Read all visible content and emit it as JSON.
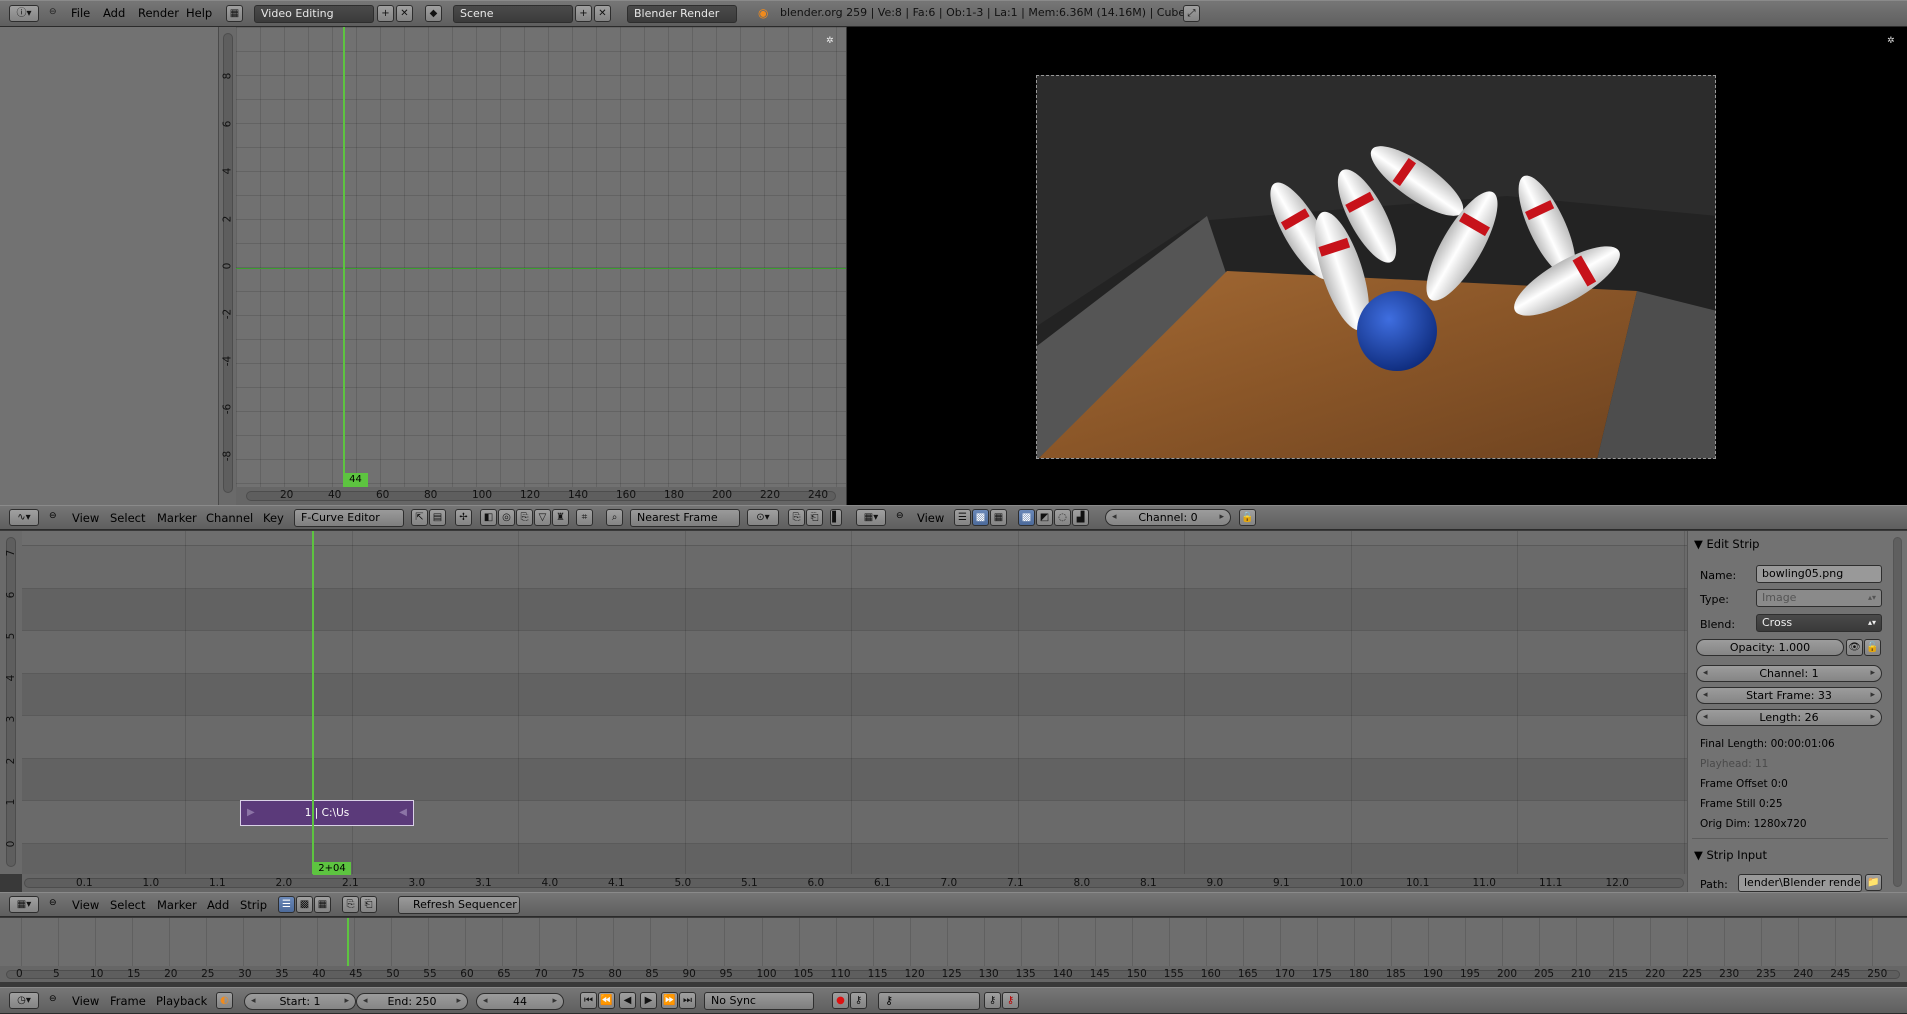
{
  "top_bar": {
    "menus": [
      "File",
      "Add",
      "Render",
      "Help"
    ],
    "screen_layout": "Video Editing",
    "scene": "Scene",
    "render_engine": "Blender Render",
    "stats": "blender.org 259 | Ve:8 | Fa:6 | Ob:1-3 | La:1 | Mem:6.36M (14.16M) | Cube"
  },
  "graph_editor": {
    "y_ticks": [
      "8",
      "6",
      "4",
      "2",
      "0",
      "-2",
      "-4",
      "-6",
      "-8"
    ],
    "x_ticks": [
      "20",
      "40",
      "60",
      "80",
      "100",
      "120",
      "140",
      "160",
      "180",
      "200",
      "220",
      "240"
    ],
    "current_frame": "44",
    "header": {
      "menus": [
        "View",
        "Select",
        "Marker",
        "Channel",
        "Key"
      ],
      "mode": "F-Curve Editor",
      "snap": "Nearest Frame"
    }
  },
  "preview": {
    "header": {
      "menus": [
        "View"
      ],
      "channel": "Channel: 0"
    }
  },
  "sequencer": {
    "channel_ticks": [
      "7",
      "6",
      "5",
      "4",
      "3",
      "2",
      "1",
      "0"
    ],
    "time_ticks": [
      "0.1",
      "1.0",
      "1.1",
      "2.0",
      "2.1",
      "3.0",
      "3.1",
      "4.0",
      "4.1",
      "5.0",
      "5.1",
      "6.0",
      "6.1",
      "7.0",
      "7.1",
      "8.0",
      "8.1",
      "9.0",
      "9.1",
      "10.0",
      "10.1",
      "11.0",
      "11.1",
      "12.0"
    ],
    "strip_label": "1 | C:\\Us",
    "current_time": "2+04",
    "header": {
      "menus": [
        "View",
        "Select",
        "Marker",
        "Add",
        "Strip"
      ],
      "refresh_label": "Refresh Sequencer"
    }
  },
  "properties": {
    "edit_strip_title": "Edit Strip",
    "name_label": "Name:",
    "name_value": "bowling05.png",
    "type_label": "Type:",
    "type_value": "Image",
    "blend_label": "Blend:",
    "blend_value": "Cross",
    "opacity": "Opacity: 1.000",
    "channel": "Channel: 1",
    "start_frame": "Start Frame: 33",
    "length": "Length: 26",
    "final_length": "Final Length: 00:00:01:06",
    "playhead": "Playhead: 11",
    "frame_offset": "Frame Offset 0:0",
    "frame_still": "Frame Still 0:25",
    "orig_dim": "Orig Dim: 1280x720",
    "strip_input_title": "Strip Input",
    "path_label": "Path:",
    "path_value": "lender\\Blender renders\\"
  },
  "timeline": {
    "ticks": [
      "0",
      "5",
      "10",
      "15",
      "20",
      "25",
      "30",
      "35",
      "40",
      "45",
      "50",
      "55",
      "60",
      "65",
      "70",
      "75",
      "80",
      "85",
      "90",
      "95",
      "100",
      "105",
      "110",
      "115",
      "120",
      "125",
      "130",
      "135",
      "140",
      "145",
      "150",
      "155",
      "160",
      "165",
      "170",
      "175",
      "180",
      "185",
      "190",
      "195",
      "200",
      "205",
      "210",
      "215",
      "220",
      "225",
      "230",
      "235",
      "240",
      "245",
      "250"
    ],
    "header": {
      "menus": [
        "View",
        "Frame",
        "Playback"
      ],
      "start": "Start: 1",
      "end": "End: 250",
      "current": "44",
      "sync": "No Sync"
    }
  }
}
